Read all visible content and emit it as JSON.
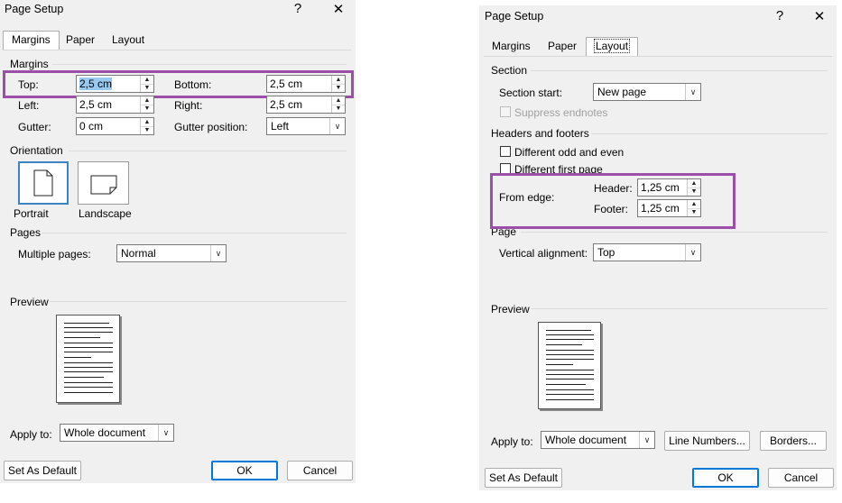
{
  "left_dialog": {
    "title": "Page Setup",
    "help": "?",
    "close": "✕",
    "tabs": [
      "Margins",
      "Paper",
      "Layout"
    ],
    "active_tab": "Margins",
    "margins_group": "Margins",
    "top_label": "Top:",
    "top_value": "2,5 cm",
    "bottom_label": "Bottom:",
    "bottom_value": "2,5 cm",
    "left_label": "Left:",
    "left_value": "2,5 cm",
    "right_label": "Right:",
    "right_value": "2,5 cm",
    "gutter_label": "Gutter:",
    "gutter_value": "0 cm",
    "gutter_pos_label": "Gutter position:",
    "gutter_pos_value": "Left",
    "orientation_group": "Orientation",
    "portrait": "Portrait",
    "landscape": "Landscape",
    "pages_group": "Pages",
    "multiple_pages_label": "Multiple pages:",
    "multiple_pages_value": "Normal",
    "preview_group": "Preview",
    "apply_to_label": "Apply to:",
    "apply_to_value": "Whole document",
    "set_default": "Set As Default",
    "ok": "OK",
    "cancel": "Cancel"
  },
  "right_dialog": {
    "title": "Page Setup",
    "help": "?",
    "close": "✕",
    "tabs": [
      "Margins",
      "Paper",
      "Layout"
    ],
    "active_tab": "Layout",
    "section_group": "Section",
    "section_start_label": "Section start:",
    "section_start_value": "New page",
    "suppress_endnotes": "Suppress endnotes",
    "headers_group": "Headers and footers",
    "diff_odd_even": "Different odd and even",
    "diff_first_page": "Different first page",
    "from_edge_label": "From edge:",
    "header_label": "Header:",
    "header_value": "1,25 cm",
    "footer_label": "Footer:",
    "footer_value": "1,25 cm",
    "page_group": "Page",
    "vertical_alignment_label": "Vertical alignment:",
    "vertical_alignment_value": "Top",
    "preview_group": "Preview",
    "apply_to_label": "Apply to:",
    "apply_to_value": "Whole document",
    "line_numbers": "Line Numbers...",
    "borders": "Borders...",
    "set_default": "Set As Default",
    "ok": "OK",
    "cancel": "Cancel"
  },
  "colors": {
    "highlight": "#9b4fa8",
    "dialog_bg": "#f0f0f0",
    "default_button_border": "#0078d7",
    "selection": "#99c9ef"
  }
}
